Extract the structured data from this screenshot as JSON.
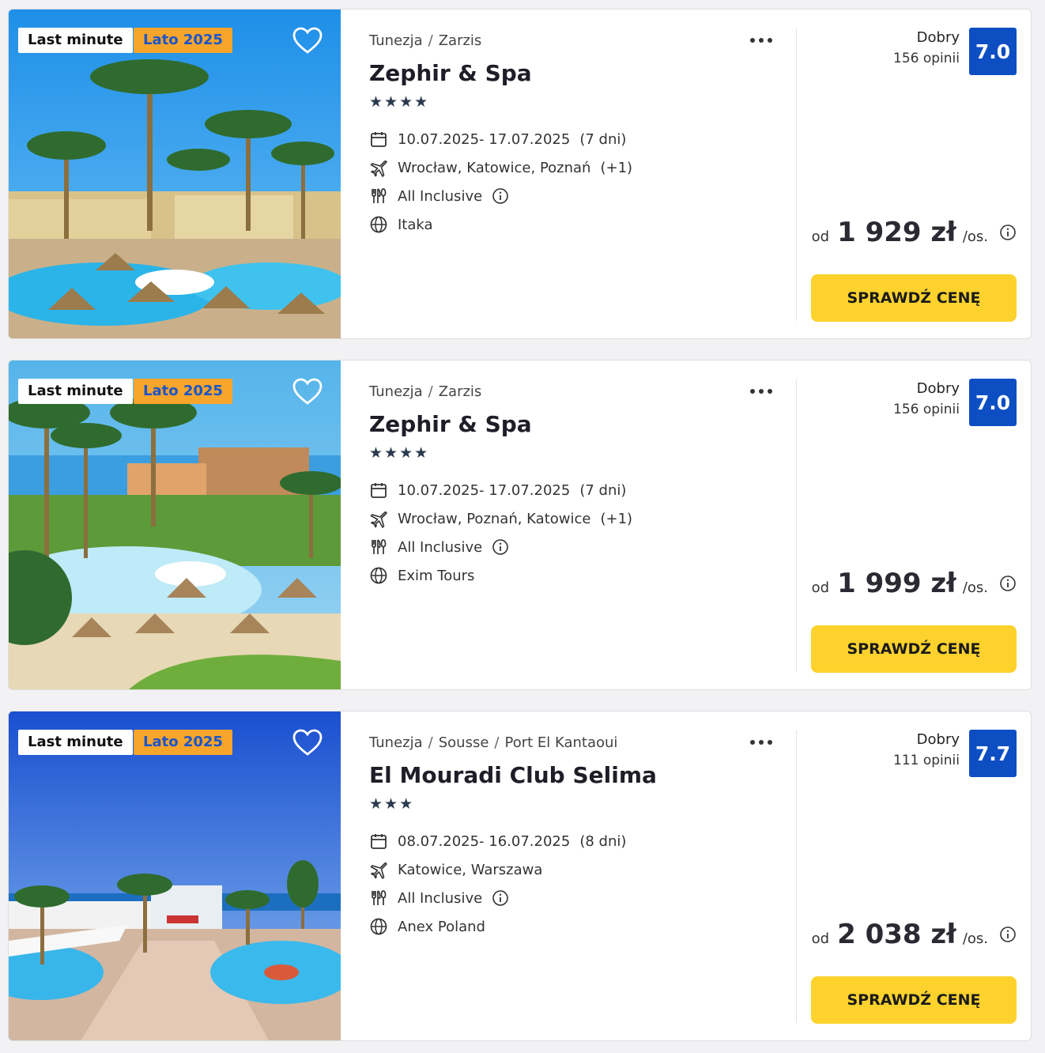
{
  "colors": {
    "accent": "#0d4fc3",
    "cta": "#fdd22d",
    "season_badge": "#f7a52b",
    "season_text": "#1b55c9"
  },
  "offers": [
    {
      "badges": [
        "Last minute",
        "Lato 2025"
      ],
      "breadcrumb": [
        "Tunezja",
        "Zarzis"
      ],
      "name": "Zephir & Spa",
      "stars": "★★★★",
      "star_count": 4,
      "dates": "10.07.2025- 17.07.2025",
      "duration": "(7 dni)",
      "airports": "Wrocław, Katowice, Poznań",
      "airports_extra": "(+1)",
      "board": "All Inclusive",
      "operator": "Itaka",
      "rating_label": "Dobry",
      "rating_count": "156 opinii",
      "rating_score": "7.0",
      "price_prefix": "od",
      "price": "1 929 zł",
      "price_suffix": "/os.",
      "cta": "SPRAWDŹ CENĘ",
      "image_icon": "palm-resort-photo"
    },
    {
      "badges": [
        "Last minute",
        "Lato 2025"
      ],
      "breadcrumb": [
        "Tunezja",
        "Zarzis"
      ],
      "name": "Zephir & Spa",
      "stars": "★★★★",
      "star_count": 4,
      "dates": "10.07.2025- 17.07.2025",
      "duration": "(7 dni)",
      "airports": "Wrocław, Poznań, Katowice",
      "airports_extra": "(+1)",
      "board": "All Inclusive",
      "operator": "Exim Tours",
      "rating_label": "Dobry",
      "rating_count": "156 opinii",
      "rating_score": "7.0",
      "price_prefix": "od",
      "price": "1 999 zł",
      "price_suffix": "/os.",
      "cta": "SPRAWDŹ CENĘ",
      "image_icon": "pool-resort-photo"
    },
    {
      "badges": [
        "Last minute",
        "Lato 2025"
      ],
      "breadcrumb": [
        "Tunezja",
        "Sousse",
        "Port El Kantaoui"
      ],
      "name": "El Mouradi Club Selima",
      "stars": "★★★",
      "star_count": 3,
      "dates": "08.07.2025- 16.07.2025",
      "duration": "(8 dni)",
      "airports": "Katowice, Warszawa",
      "airports_extra": "",
      "board": "All Inclusive",
      "operator": "Anex Poland",
      "rating_label": "Dobry",
      "rating_count": "111 opinii",
      "rating_score": "7.7",
      "price_prefix": "od",
      "price": "2 038 zł",
      "price_suffix": "/os.",
      "cta": "SPRAWDŹ CENĘ",
      "image_icon": "seaside-resort-photo"
    }
  ]
}
